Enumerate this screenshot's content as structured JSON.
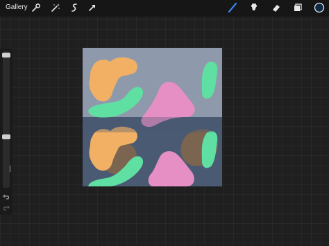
{
  "top_bar": {
    "gallery_label": "Gallery",
    "left_tools": [
      "wrench-icon",
      "magic-wand-icon",
      "selection-icon",
      "transform-arrow-icon"
    ],
    "right_tools": [
      "brush-icon",
      "smudge-icon",
      "eraser-icon",
      "layers-icon",
      "color-swatch-icon"
    ],
    "active_tool": "brush-icon"
  },
  "sidebar": {
    "brush_size_level": 0.05,
    "opacity_level": 0.05,
    "buttons": [
      "modify-button",
      "undo-icon",
      "redo-icon"
    ]
  },
  "canvas": {
    "top_color": "#8e9aab",
    "bottom_color": "#4a5a72",
    "shape_colors": {
      "orange": "#f2b064",
      "green": "#5fe0a2",
      "pink": "#e68fc4",
      "brown": "#7b6450"
    }
  },
  "colors": {
    "brush_accent": "#3b82f6",
    "current_color": "#0f2a44"
  }
}
